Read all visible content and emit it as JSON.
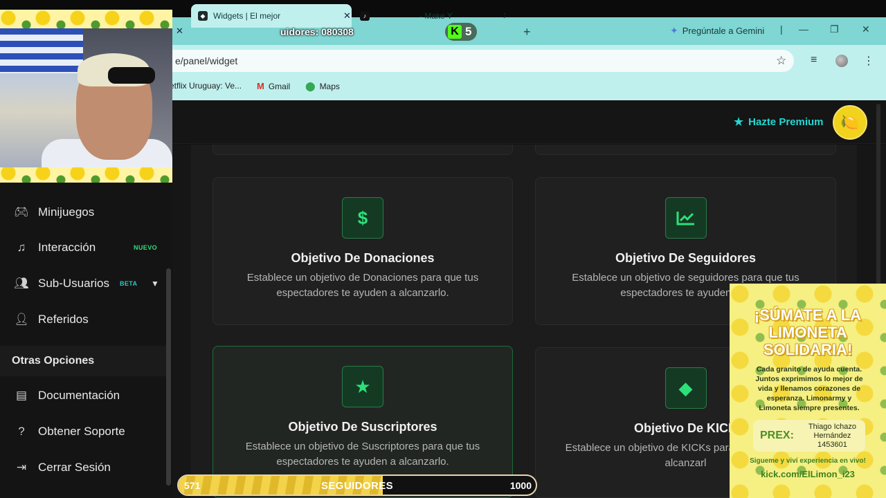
{
  "browser": {
    "tabs": [
      {
        "label": "Widgets | El mejor",
        "active": true
      },
      {
        "label": "- Make Y"
      }
    ],
    "followers_overlay": "uidores: 080308",
    "kick_count": "5",
    "new_tab_icon": "plus-icon",
    "gemini_label": "Pregúntale a Gemini",
    "url": "e/panel/widget",
    "bookmarks": [
      "etflix Uruguay: Ve...",
      "Gmail",
      "Maps"
    ]
  },
  "header": {
    "premium_label": "Hazte Premium"
  },
  "sidebar": {
    "items": [
      {
        "label": "Minijuegos",
        "icon": "gamepad-icon"
      },
      {
        "label": "Interacción",
        "icon": "music-icon",
        "badge": "NUEVO"
      },
      {
        "label": "Sub-Usuarios",
        "icon": "users-icon",
        "badge": "BETA"
      },
      {
        "label": "Referidos",
        "icon": "user-group-icon"
      }
    ],
    "section_title": "Otras Opciones",
    "other_items": [
      {
        "label": "Documentación",
        "icon": "document-icon"
      },
      {
        "label": "Obtener Soporte",
        "icon": "help-icon"
      },
      {
        "label": "Cerrar Sesión",
        "icon": "logout-icon"
      }
    ]
  },
  "cards": [
    {
      "title": "Objetivo De Donaciones",
      "desc": "Establece un objetivo de Donaciones para que tus espectadores te ayuden a alcanzarlo.",
      "icon": "dollar-icon"
    },
    {
      "title": "Objetivo De Seguidores",
      "desc": "Establece un objetivo de seguidores para que tus espectadores te ayuden a al",
      "icon": "chart-icon"
    },
    {
      "title": "Objetivo De Suscriptores",
      "desc": "Establece un objetivo de Suscriptores para que tus espectadores te ayuden a alcanzarlo.",
      "icon": "star-icon"
    },
    {
      "title": "Objetivo De KICK",
      "desc": "Establece un objetivo de KICKs para qu te ayuden a alcanzarl",
      "icon": "diamond-icon"
    }
  ],
  "promo": {
    "heading": "¡SÚMATE A LA LIMONETA SOLIDARIA!",
    "body": "Cada granito de ayuda cuenta. Juntos exprimimos lo mejor de vida y llenamos corazones de esperanza. Limonarmy y Limoneta siempre presentes.",
    "prex_label": "PREX:",
    "prex_name": "Thiago Ichazo Hernández",
    "prex_number": "1453601",
    "footer": "Sigueme y viví experiencia en vivo!",
    "link": "kick.com/ElLimon_i23"
  },
  "follower_goal": {
    "current": "571",
    "label": "SEGUIDORES",
    "goal": "1000",
    "progress": 0.571
  },
  "colors": {
    "accent_green": "#2ee07a",
    "premium_cyan": "#25d7d2",
    "tabstrip": "#7fd6d3"
  }
}
